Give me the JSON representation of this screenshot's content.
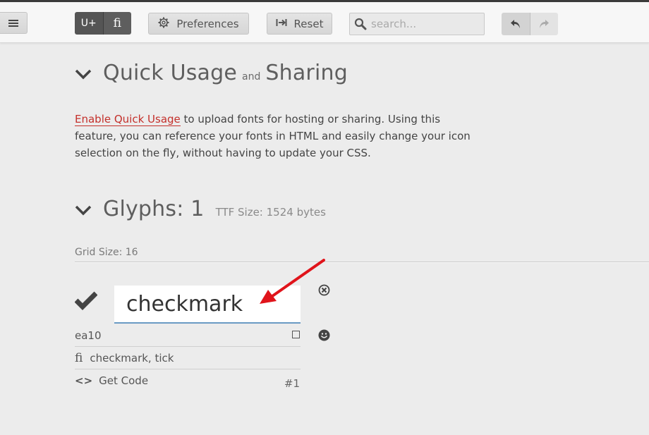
{
  "toolbar": {
    "unicode_label": "U+",
    "ligature_label": "ﬁ",
    "preferences_label": "Preferences",
    "reset_label": "Reset",
    "search_placeholder": "search..."
  },
  "quick_usage": {
    "title_main": "Quick Usage",
    "title_and": "and",
    "title_end": "Sharing",
    "link_text": "Enable Quick Usage",
    "description": " to upload fonts for hosting or sharing. Using this feature, you can reference your fonts in HTML and easily change your icon selection on the fly, without having to update your CSS."
  },
  "glyphs": {
    "title": "Glyphs: 1",
    "ttf_size": "TTF Size: 1524 bytes",
    "grid_size": "Grid Size: 16",
    "items": [
      {
        "name": "checkmark",
        "code": "ea10",
        "tags": "checkmark, tick",
        "get_code_label": "Get Code",
        "index": "#1"
      }
    ]
  },
  "colors": {
    "accent_link": "#c4302b",
    "arrow": "#e0141b",
    "input_underline": "#6a9ac4"
  }
}
